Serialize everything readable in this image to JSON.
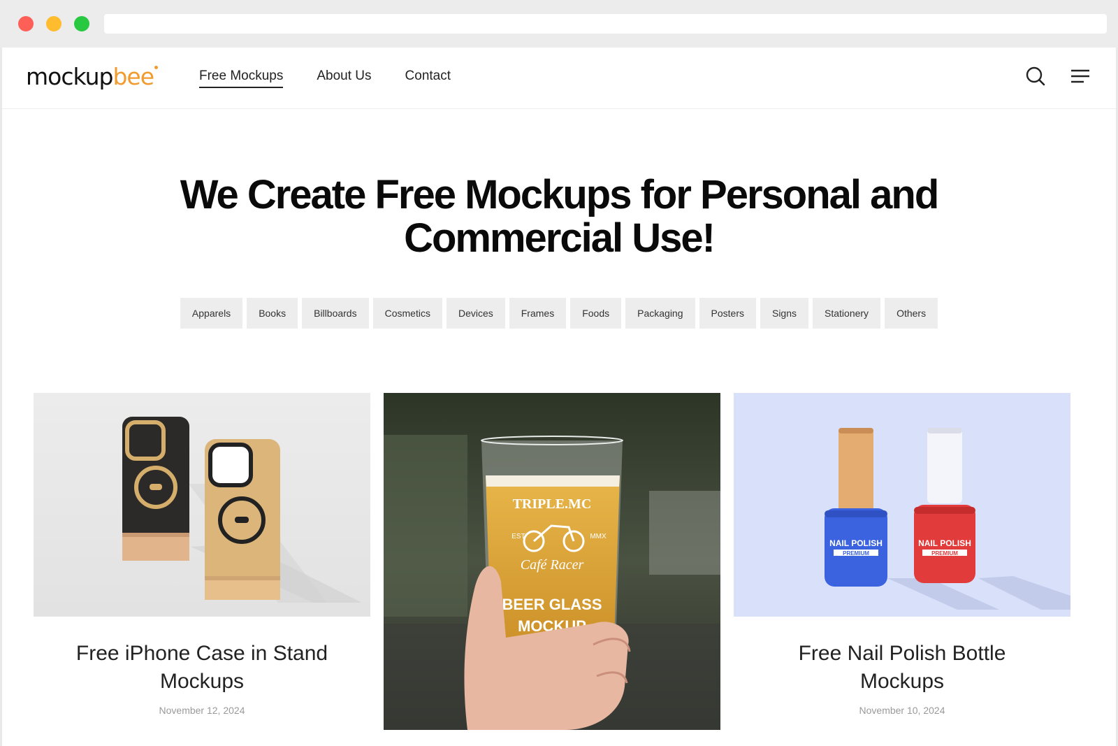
{
  "logo": {
    "text_main": "mockup",
    "text_accent": "bee"
  },
  "nav": [
    {
      "label": "Free Mockups"
    },
    {
      "label": "About Us"
    },
    {
      "label": "Contact"
    }
  ],
  "hero": {
    "line1": "We Create Free Mockups for Personal and",
    "line2": "Commercial Use!"
  },
  "categories": [
    "Apparels",
    "Books",
    "Billboards",
    "Cosmetics",
    "Devices",
    "Frames",
    "Foods",
    "Packaging",
    "Posters",
    "Signs",
    "Stationery",
    "Others"
  ],
  "cards": [
    {
      "title": "Free iPhone Case in Stand Mockups",
      "date": "November 12, 2024"
    },
    {
      "glass_text": [
        "TRIPLE.MC",
        "EST",
        "MMX",
        "Café Racer",
        "BEER GLASS",
        "MOCKUP"
      ]
    },
    {
      "title": "Free Nail Polish Bottle Mockups",
      "date": "November 10, 2024",
      "bottle_label": [
        "NAIL POLISH",
        "PREMIUM"
      ]
    }
  ],
  "colors": {
    "accent": "#f29a2e",
    "chip_bg": "#ededee",
    "nail_blue": "#3b63e0",
    "nail_red": "#e23b3b",
    "nail_bg": "#d8e0fa"
  }
}
